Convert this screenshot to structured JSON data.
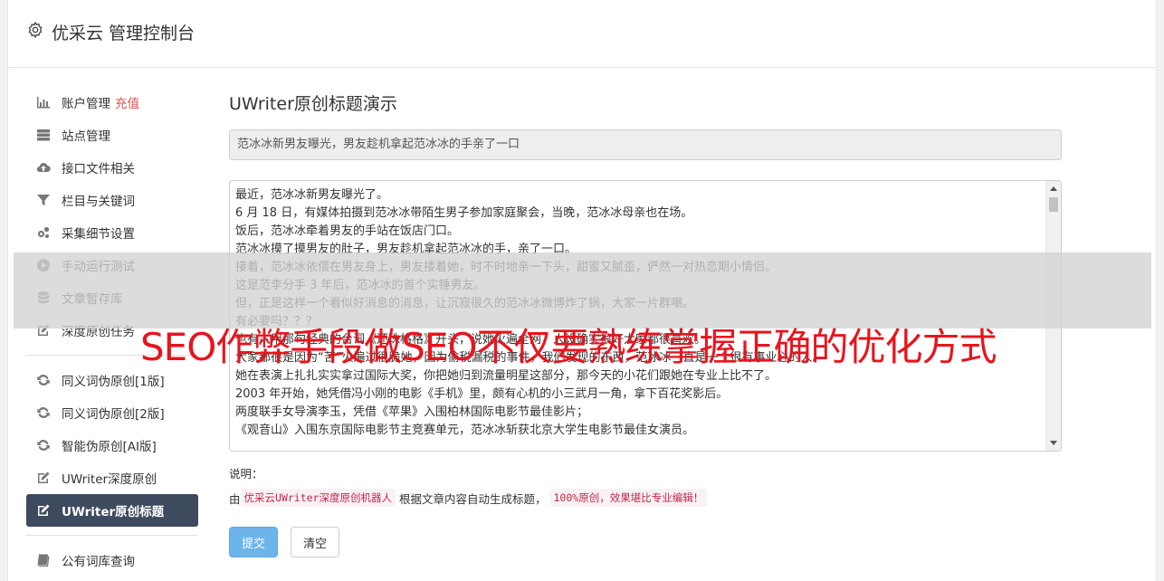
{
  "header": {
    "title": "优采云 管理控制台",
    "icon": "gear-icon"
  },
  "sidebar": {
    "groups": [
      [
        {
          "label": "账户管理",
          "accent": "充值",
          "icon": "bar-chart-icon"
        },
        {
          "label": "站点管理",
          "icon": "server-icon"
        },
        {
          "label": "接口文件相关",
          "icon": "cloud-upload-icon"
        },
        {
          "label": "栏目与关键词",
          "icon": "filter-icon"
        },
        {
          "label": "采集细节设置",
          "icon": "gears-icon"
        },
        {
          "label": "手动运行测试",
          "icon": "play-circle-icon"
        },
        {
          "label": "文章暂存库",
          "icon": "database-icon"
        },
        {
          "label": "深度原创任务",
          "icon": "edit-icon"
        }
      ],
      [
        {
          "label": "同义词伪原创[1版]",
          "icon": "refresh-icon"
        },
        {
          "label": "同义词伪原创[2版]",
          "icon": "refresh-icon"
        },
        {
          "label": "智能伪原创[AI版]",
          "icon": "refresh-icon"
        },
        {
          "label": "UWriter深度原创",
          "icon": "edit-icon"
        },
        {
          "label": "UWriter原创标题",
          "icon": "edit-icon",
          "active": true
        }
      ],
      [
        {
          "label": "公有词库查询",
          "icon": "book-icon"
        }
      ]
    ]
  },
  "main": {
    "heading": "UWriter原创标题演示",
    "title_value": "范冰冰新男友曝光，男友趁机拿起范冰冰的手亲了一口",
    "content_lines": [
      "最近，范冰冰新男友曝光了。",
      "6 月 18 日，有媒体拍摄到范冰冰带陌生男子参加家庭聚会，当晚，范冰冰母亲也在场。",
      "饭后，范冰冰牵着男友的手站在饭店门口。",
      "范冰冰摸了摸男友的肚子，男友趁机拿起范冰冰的手，亲了一口。",
      "接着，范冰冰依偎在男友身上，男友搂着她，时不时地亲一下头，甜蜜又腻歪，俨然一对热恋期小情侣。",
      "这是范李分手 3 年后，范冰冰的首个实锤男友。",
      "但，正是这样一个看似好消息的消息，让沉寂很久的范冰冰微博炸了锅，大家一片群嘲。",
      "有必要吗？？？",
      "也有人用那句经典的台词《还珠格格》开头，说她火遍全网，人设确实很好大家都很喜欢。",
      "大家都很是因为“苦”火遍过很脆她，因为偷税漏税的事件，我们发现的东西，范冰冰一直是一个很有事业心的人。",
      "她在表演上扎扎实实拿过国际大奖，你把她归到流量明星这部分，那今天的小花们跟她在专业上比不了。",
      "2003 年开始，她凭借冯小刚的电影《手机》里，颇有心机的小三武月一角，拿下百花奖影后。",
      "两度联手女导演李玉，凭借《苹果》入围柏林国际电影节最佳影片；",
      "《观音山》入围东京国际电影节主竞赛单元，范冰冰斩获北京大学生电影节最佳女演员。"
    ],
    "help_label": "说明：",
    "help_by": "由",
    "help_code1": "优采云UWriter深度原创机器人",
    "help_mid": "根据文章内容自动生成标题，",
    "help_code2": "100%原创，效果堪比专业编辑！",
    "submit_label": "提交",
    "clear_label": "清空"
  },
  "overlay": {
    "text": "SEO作弊手段做SEO不仅要熟练掌握正确的优化方式"
  }
}
